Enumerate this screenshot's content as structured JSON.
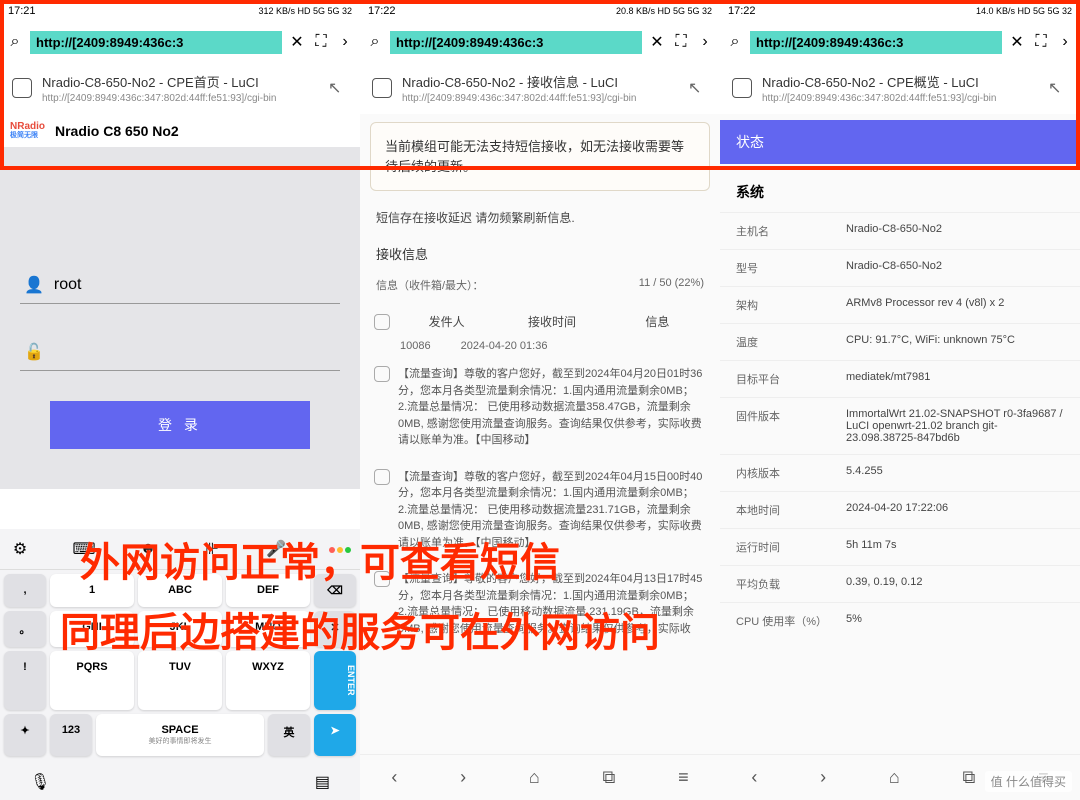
{
  "overlay": {
    "line1": "外网访问正常，可查看短信",
    "line2": "同理后边搭建的服务可在外网访问"
  },
  "watermark": "值 什么值得买",
  "url": "http://[2409:8949:436c:3",
  "p1": {
    "time": "17:21",
    "signal": "312 KB/s HD 5G 5G 32",
    "sugg_title": "Nradio-C8-650-No2 - CPE首页 - LuCI",
    "sugg_url": "http://[2409:8949:436c:347:802d:44ff:fe51:93]/cgi-bin",
    "logo": "NRadio",
    "logo_sub": "极简无限",
    "brand": "Nradio C8 650 No2",
    "user": "root",
    "login": "登 录",
    "keys": {
      "row2": [
        "GHI",
        "JKL",
        "MNO"
      ],
      "space_label": "SPACE",
      "space_sub": "美好的事情即将发生",
      "lang": "英",
      "num": "123"
    }
  },
  "p2": {
    "time": "17:22",
    "signal": "20.8 KB/s HD 5G 5G 32",
    "sugg_title": "Nradio-C8-650-No2 - 接收信息 - LuCI",
    "sugg_url": "http://[2409:8949:436c:347:802d:44ff:fe51:93]/cgi-bin",
    "warn": "当前模组可能无法支持短信接收，如无法接收需要等待后续的更新。",
    "delay_note": "短信存在接收延迟 请勿频繁刷新信息.",
    "section": "接收信息",
    "inbox_label": "信息（收件箱/最大）：",
    "inbox_val": "11 / 50 (22%)",
    "th": [
      "发件人",
      "接收时间",
      "信息"
    ],
    "msgs": [
      {
        "sender": "10086",
        "time": "2024-04-20 01:36",
        "body": "【流量查询】尊敬的客户您好，截至到2024年04月20日01时36分，您本月各类型流量剩余情况：1.国内通用流量剩余0MB； 2.流量总量情况： 已使用移动数据流量358.47GB，流量剩余0MB, 感谢您使用流量查询服务。查询结果仅供参考，实际收费请以账单为准。【中国移动】"
      },
      {
        "sender": "",
        "time": "",
        "body": "【流量查询】尊敬的客户您好，截至到2024年04月15日00时40分，您本月各类型流量剩余情况：1.国内通用流量剩余0MB； 2.流量总量情况： 已使用移动数据流量231.71GB，流量剩余0MB, 感谢您使用流量查询服务。查询结果仅供参考，实际收费请以账单为准。【中国移动】"
      },
      {
        "sender": "",
        "time": "",
        "body": "【流量查询】尊敬的客户您好，截至到2024年04月13日17时45分，您本月各类型流量剩余情况：1.国内通用流量剩余0MB； 2.流量总量情况： 已使用移动数据流量 231.19GB，流量剩余0MB, 感谢您使用流量查询服务。查询结果仅供参考，实际收"
      }
    ]
  },
  "p3": {
    "time": "17:22",
    "signal": "14.0 KB/s HD 5G 5G 32",
    "sugg_title": "Nradio-C8-650-No2 - CPE概览 - LuCI",
    "sugg_url": "http://[2409:8949:436c:347:802d:44ff:fe51:93]/cgi-bin",
    "status": "状态",
    "sys": "系统",
    "rows": [
      {
        "lbl": "主机名",
        "val": "Nradio-C8-650-No2"
      },
      {
        "lbl": "型号",
        "val": "Nradio-C8-650-No2"
      },
      {
        "lbl": "架构",
        "val": "ARMv8 Processor rev 4 (v8l) x 2"
      },
      {
        "lbl": "温度",
        "val": "CPU: 91.7°C, WiFi: unknown 75°C"
      },
      {
        "lbl": "目标平台",
        "val": "mediatek/mt7981"
      },
      {
        "lbl": "固件版本",
        "val": "ImmortalWrt 21.02-SNAPSHOT r0-3fa9687 / LuCI openwrt-21.02 branch git-23.098.38725-847bd6b"
      },
      {
        "lbl": "内核版本",
        "val": "5.4.255"
      },
      {
        "lbl": "本地时间",
        "val": "2024-04-20 17:22:06"
      },
      {
        "lbl": "运行时间",
        "val": "5h 11m 7s"
      },
      {
        "lbl": "平均负载",
        "val": "0.39, 0.19, 0.12"
      },
      {
        "lbl": "CPU 使用率（%）",
        "val": "5%"
      }
    ]
  }
}
